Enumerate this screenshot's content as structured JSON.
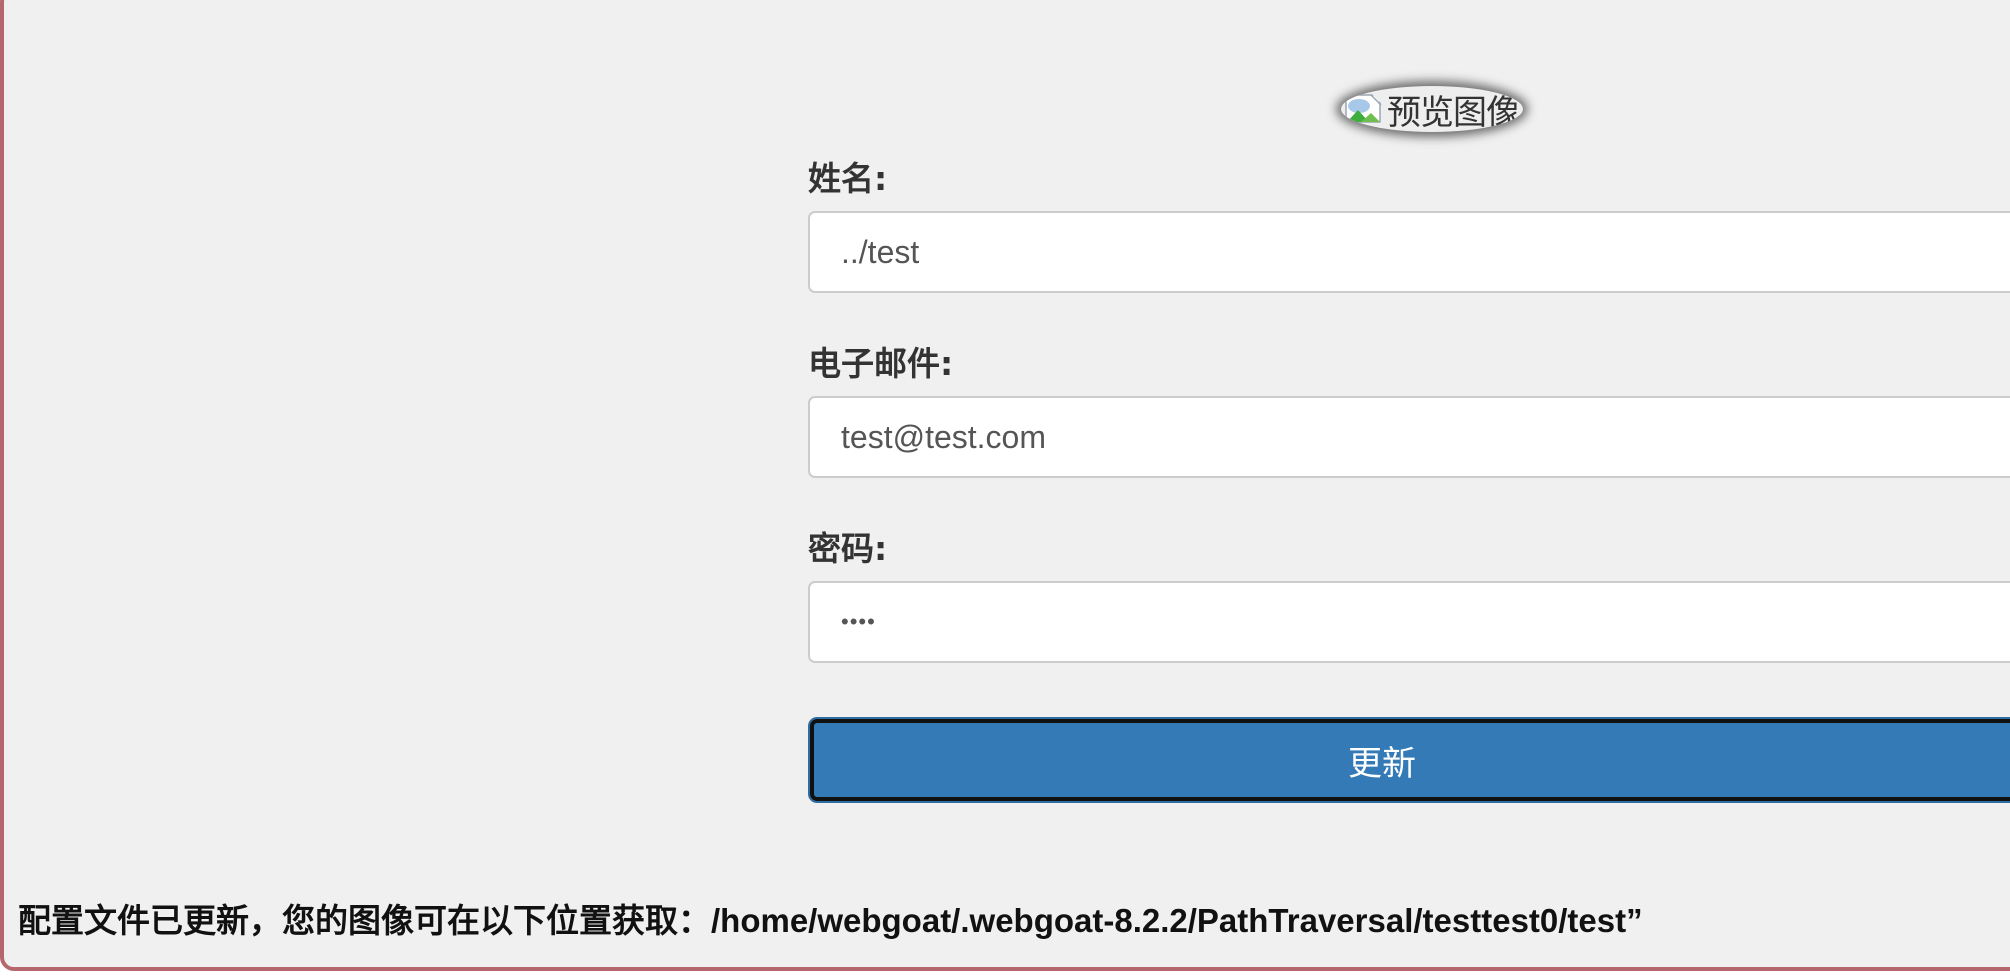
{
  "preview": {
    "alt_text": "预览图像",
    "icon": "broken-image-icon"
  },
  "form": {
    "name": {
      "label": "姓名:",
      "value": "../test"
    },
    "email": {
      "label": "电子邮件:",
      "value": "test@test.com"
    },
    "password": {
      "label": "密码:",
      "value": "••••"
    },
    "submit_label": "更新"
  },
  "feedback": "配置文件已更新，您的图像可在以下位置获取：/home/webgoat/.webgoat-8.2.2/PathTraversal/testtest0/test”",
  "colors": {
    "button": "#337ab7",
    "panel_border": "#b5676d",
    "panel_bg": "#f0f0f0"
  }
}
